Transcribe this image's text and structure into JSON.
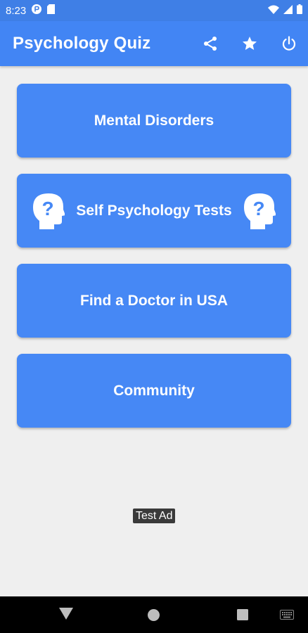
{
  "status_bar": {
    "time": "8:23",
    "left_icons": [
      "settings-badge-icon",
      "sd-card-icon"
    ],
    "right_icons": [
      "wifi-icon",
      "signal-icon",
      "battery-icon"
    ]
  },
  "app_bar": {
    "title": "Psychology Quiz",
    "actions": [
      "share-icon",
      "star-icon",
      "power-icon"
    ]
  },
  "menu": {
    "items": [
      {
        "label": "Mental Disorders"
      },
      {
        "label": "Self Psychology Tests",
        "icons": [
          "head-question-icon",
          "head-question-icon"
        ]
      },
      {
        "label": "Find a Doctor in USA"
      },
      {
        "label": "Community"
      }
    ]
  },
  "ad": {
    "label": "Test Ad"
  },
  "nav_bar": {
    "items": [
      "back-icon",
      "home-icon",
      "recents-icon",
      "keyboard-icon"
    ]
  },
  "colors": {
    "status_bar": "#3f7fe6",
    "app_bar": "#4285f4",
    "button": "#4688f5",
    "background": "#efefef"
  }
}
